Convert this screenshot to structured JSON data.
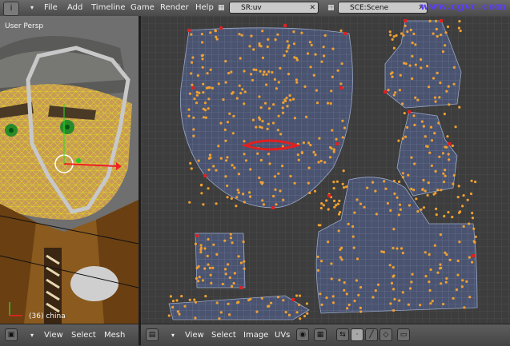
{
  "menubar": {
    "info_icon": "i",
    "items": [
      "File",
      "Add",
      "Timeline",
      "Game",
      "Render",
      "Help"
    ],
    "screen_field": "SR:uv",
    "scene_field": "SCE:Scene",
    "watermark": "www.cgvc.com"
  },
  "view3d": {
    "label": "User Persp",
    "object_label": "(36) china",
    "menu": [
      "View",
      "Select",
      "Mesh"
    ]
  },
  "uv_editor": {
    "menu": [
      "View",
      "Select",
      "Image",
      "UVs"
    ]
  },
  "colors": {
    "vertex": "#f0a030",
    "pinned": "#e02020",
    "wire": "#9aa8c8",
    "mesh_face": "#4a5470",
    "selection_wire": "#e0e020"
  }
}
